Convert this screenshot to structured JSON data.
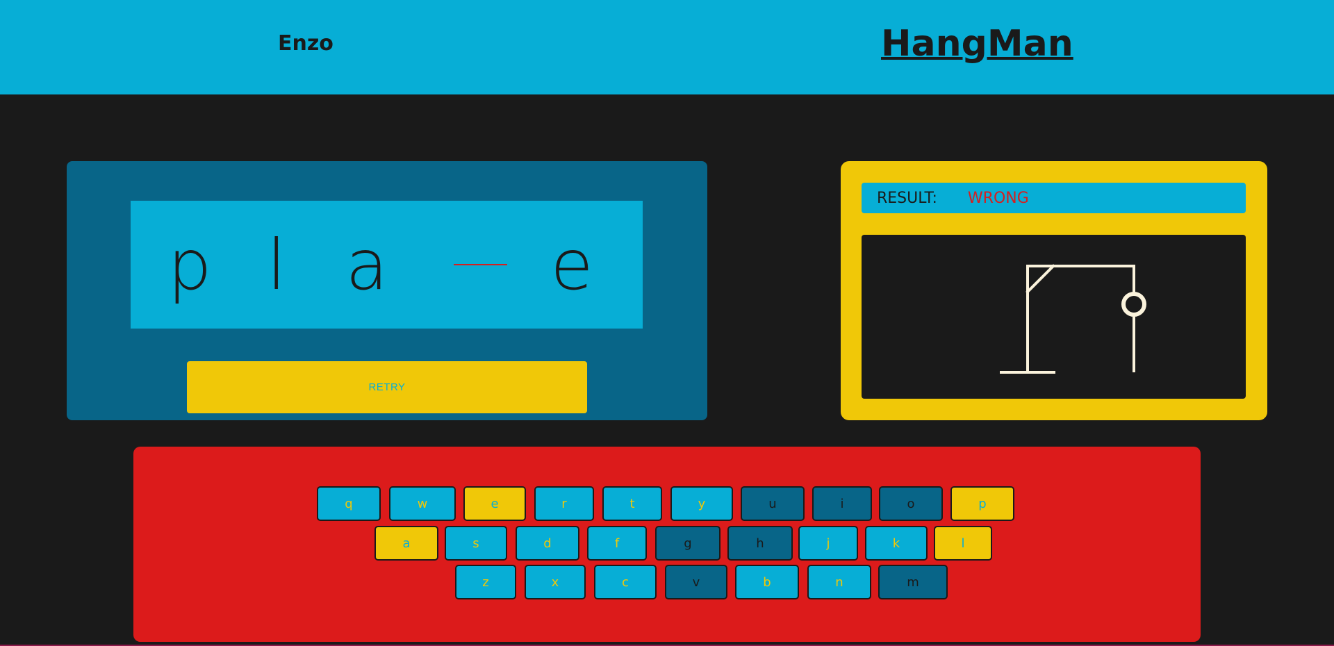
{
  "header": {
    "player_name": "Enzo",
    "title": "HangMan"
  },
  "word": {
    "slots": [
      "p",
      "l",
      "a",
      "",
      "e"
    ]
  },
  "retry_label": "RETRY",
  "result": {
    "label": "RESULT:",
    "value": "WRONG"
  },
  "keyboard": {
    "row1": [
      {
        "letter": "q",
        "state": "unused"
      },
      {
        "letter": "w",
        "state": "unused"
      },
      {
        "letter": "e",
        "state": "correct"
      },
      {
        "letter": "r",
        "state": "unused"
      },
      {
        "letter": "t",
        "state": "unused"
      },
      {
        "letter": "y",
        "state": "unused"
      },
      {
        "letter": "u",
        "state": "wrong"
      },
      {
        "letter": "i",
        "state": "wrong"
      },
      {
        "letter": "o",
        "state": "wrong"
      },
      {
        "letter": "p",
        "state": "correct"
      }
    ],
    "row2": [
      {
        "letter": "a",
        "state": "correct"
      },
      {
        "letter": "s",
        "state": "unused"
      },
      {
        "letter": "d",
        "state": "unused"
      },
      {
        "letter": "f",
        "state": "unused"
      },
      {
        "letter": "g",
        "state": "wrong"
      },
      {
        "letter": "h",
        "state": "wrong"
      },
      {
        "letter": "j",
        "state": "unused"
      },
      {
        "letter": "k",
        "state": "unused"
      },
      {
        "letter": "l",
        "state": "correct"
      }
    ],
    "row3": [
      {
        "letter": "z",
        "state": "unused"
      },
      {
        "letter": "x",
        "state": "unused"
      },
      {
        "letter": "c",
        "state": "unused"
      },
      {
        "letter": "v",
        "state": "wrong"
      },
      {
        "letter": "b",
        "state": "unused"
      },
      {
        "letter": "n",
        "state": "unused"
      },
      {
        "letter": "m",
        "state": "wrong"
      }
    ]
  },
  "colors": {
    "header_blue": "#07aed6",
    "panel_dark_blue": "#086588",
    "yellow": "#f0c808",
    "red": "#dc1b1b",
    "background": "#1a1a1a",
    "gallows": "#fbf3dc"
  }
}
